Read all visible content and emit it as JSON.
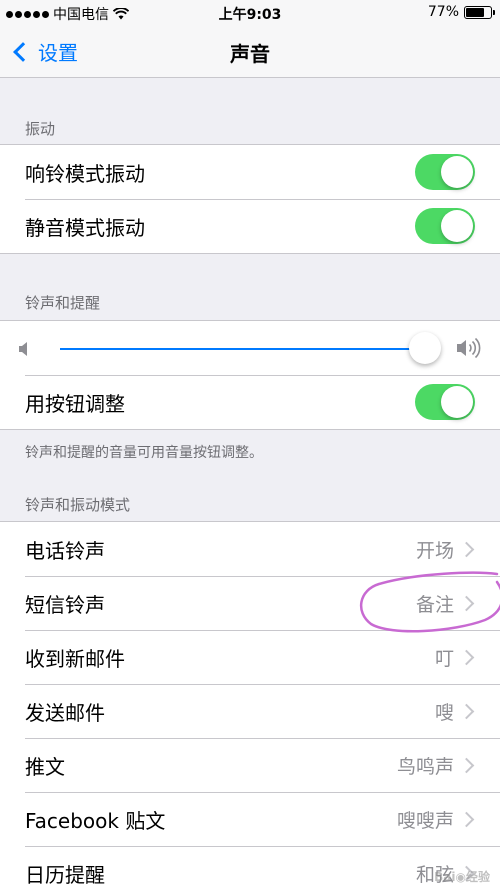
{
  "status_bar": {
    "carrier": "中国电信",
    "time": "上午9:03",
    "battery": "77%",
    "battery_level": 0.77
  },
  "nav": {
    "back_label": "设置",
    "title": "声音"
  },
  "vibration": {
    "header": "振动",
    "rows": [
      {
        "label": "响铃模式振动",
        "toggle_on": true
      },
      {
        "label": "静音模式振动",
        "toggle_on": true
      }
    ]
  },
  "ringer": {
    "header": "铃声和提醒",
    "volume_level": 0.96,
    "change_with_buttons": {
      "label": "用按钮调整",
      "toggle_on": true
    },
    "footer": "铃声和提醒的音量可用音量按钮调整。"
  },
  "patterns": {
    "header": "铃声和振动模式",
    "rows": [
      {
        "label": "电话铃声",
        "value": "开场"
      },
      {
        "label": "短信铃声",
        "value": "备注"
      },
      {
        "label": "收到新邮件",
        "value": "叮"
      },
      {
        "label": "发送邮件",
        "value": "嗖"
      },
      {
        "label": "推文",
        "value": "鸟鸣声"
      },
      {
        "label": "Facebook 贴文",
        "value": "嗖嗖声"
      },
      {
        "label": "日历提醒",
        "value": "和弦"
      }
    ]
  },
  "icons": {
    "back": "chevron-left-icon",
    "volume_low": "speaker-low-icon",
    "volume_high": "speaker-high-icon",
    "row_chevron": "chevron-right-icon"
  },
  "colors": {
    "accent": "#007aff",
    "toggle_on": "#4cd964",
    "annotation": "#c86ad2"
  }
}
